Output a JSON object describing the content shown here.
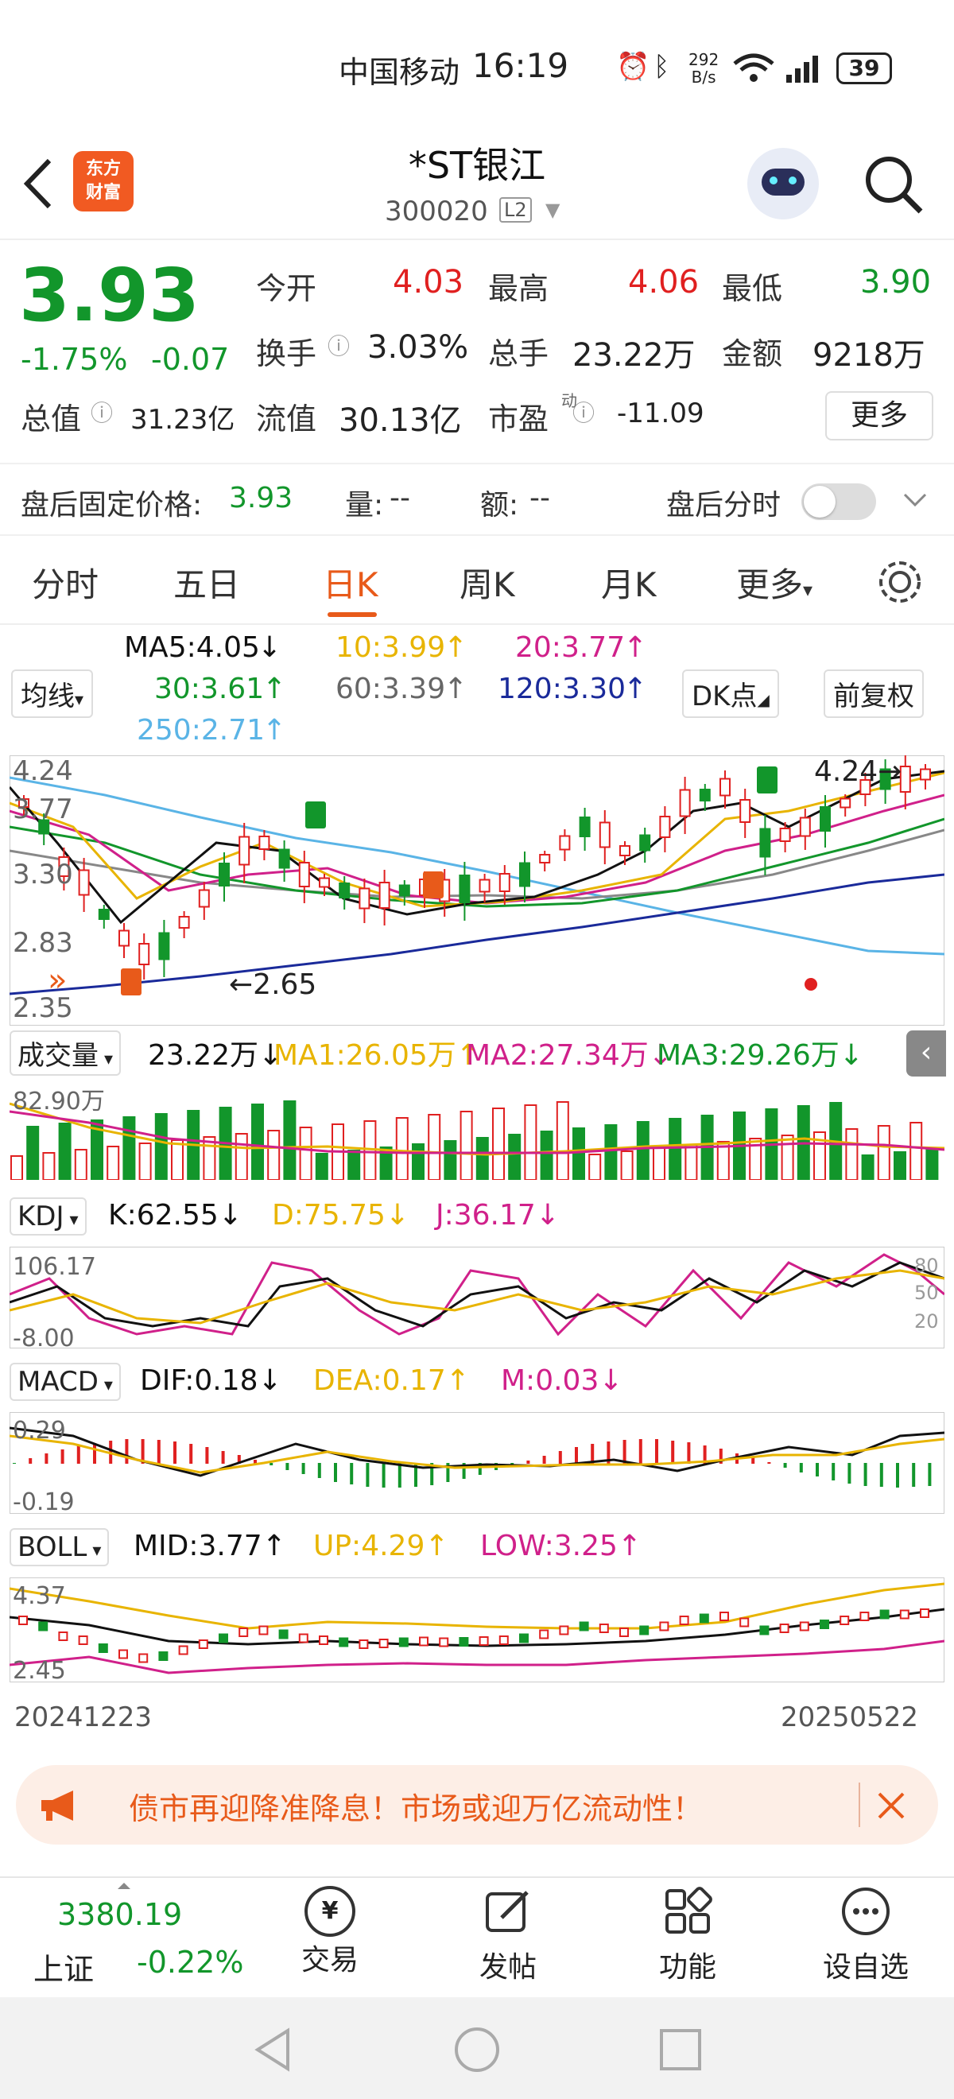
{
  "status_bar": {
    "carrier": "中国移动",
    "time": "16:19",
    "net_speed_top": "292",
    "net_speed_bottom": "B/s",
    "battery": "39"
  },
  "header": {
    "stock_name": "*ST银江",
    "stock_code": "300020",
    "level": "L2",
    "logo_line1": "东方",
    "logo_line2": "财富"
  },
  "quote": {
    "price": "3.93",
    "change_pct": "-1.75%",
    "change": "-0.07",
    "open_label": "今开",
    "open": "4.03",
    "high_label": "最高",
    "high": "4.06",
    "low_label": "最低",
    "low": "3.90",
    "turnover_label": "换手",
    "turnover": "3.03%",
    "volume_label": "总手",
    "volume": "23.22万",
    "amount_label": "金额",
    "amount": "9218万",
    "mktcap_label": "总值",
    "mktcap": "31.23亿",
    "float_label": "流值",
    "float": "30.13亿",
    "pe_label": "市盈",
    "pe_sup": "动",
    "pe": "-11.09",
    "more_button": "更多"
  },
  "after_hours": {
    "price_label": "盘后固定价格:",
    "price": "3.93",
    "vol_label": "量:",
    "vol": "--",
    "amt_label": "额:",
    "amt": "--",
    "timeshare_label": "盘后分时"
  },
  "tabs": [
    "分时",
    "五日",
    "日K",
    "周K",
    "月K",
    "更多"
  ],
  "ma": {
    "selector": "均线",
    "ma5": "MA5:4.05",
    "ma10": "10:3.99",
    "ma20": "20:3.77",
    "ma30": "30:3.61",
    "ma60": "60:3.39",
    "ma120": "120:3.30",
    "ma250": "250:2.71",
    "dk_button": "DK点",
    "adjust_button": "前复权"
  },
  "kline_axis": {
    "top": "4.24",
    "l2": "3.77",
    "l3": "3.30",
    "l4": "2.83",
    "bottom": "2.35",
    "max_label": "4.24",
    "min_label": "2.65"
  },
  "volume": {
    "selector": "成交量",
    "value": "23.22万",
    "ma1": "MA1:26.05万",
    "ma2": "MA2:27.34万",
    "ma3": "MA3:29.26万",
    "axis_top": "82.90万"
  },
  "kdj": {
    "selector": "KDJ",
    "k": "K:62.55",
    "d": "D:75.75",
    "j": "J:36.17",
    "axis_top": "106.17",
    "axis_bottom": "-8.00",
    "r80": "80",
    "r50": "50",
    "r20": "20"
  },
  "macd": {
    "selector": "MACD",
    "dif": "DIF:0.18",
    "dea": "DEA:0.17",
    "m": "M:0.03",
    "axis_top": "0.29",
    "axis_bottom": "-0.19"
  },
  "boll": {
    "selector": "BOLL",
    "mid": "MID:3.77",
    "up": "UP:4.29",
    "low": "LOW:3.25",
    "axis_top": "4.37",
    "axis_bottom": "2.45"
  },
  "dates": {
    "start": "20241223",
    "end": "20250522"
  },
  "banner": {
    "text": "债市再迎降准降息！市场或迎万亿流动性！"
  },
  "bottom": {
    "index_value": "3380.19",
    "index_name": "上证",
    "index_change": "-0.22%",
    "trade": "交易",
    "post": "发帖",
    "function": "功能",
    "watchlist": "设自选"
  },
  "colors": {
    "up": "#e02020",
    "down": "#12962b",
    "accent": "#e85a1a",
    "ma5": "#111111",
    "ma10": "#e8b400",
    "ma20": "#d0208a",
    "ma30": "#12962b",
    "ma60": "#888888",
    "ma120": "#1a2a9a",
    "ma250": "#5ab4e6"
  }
}
